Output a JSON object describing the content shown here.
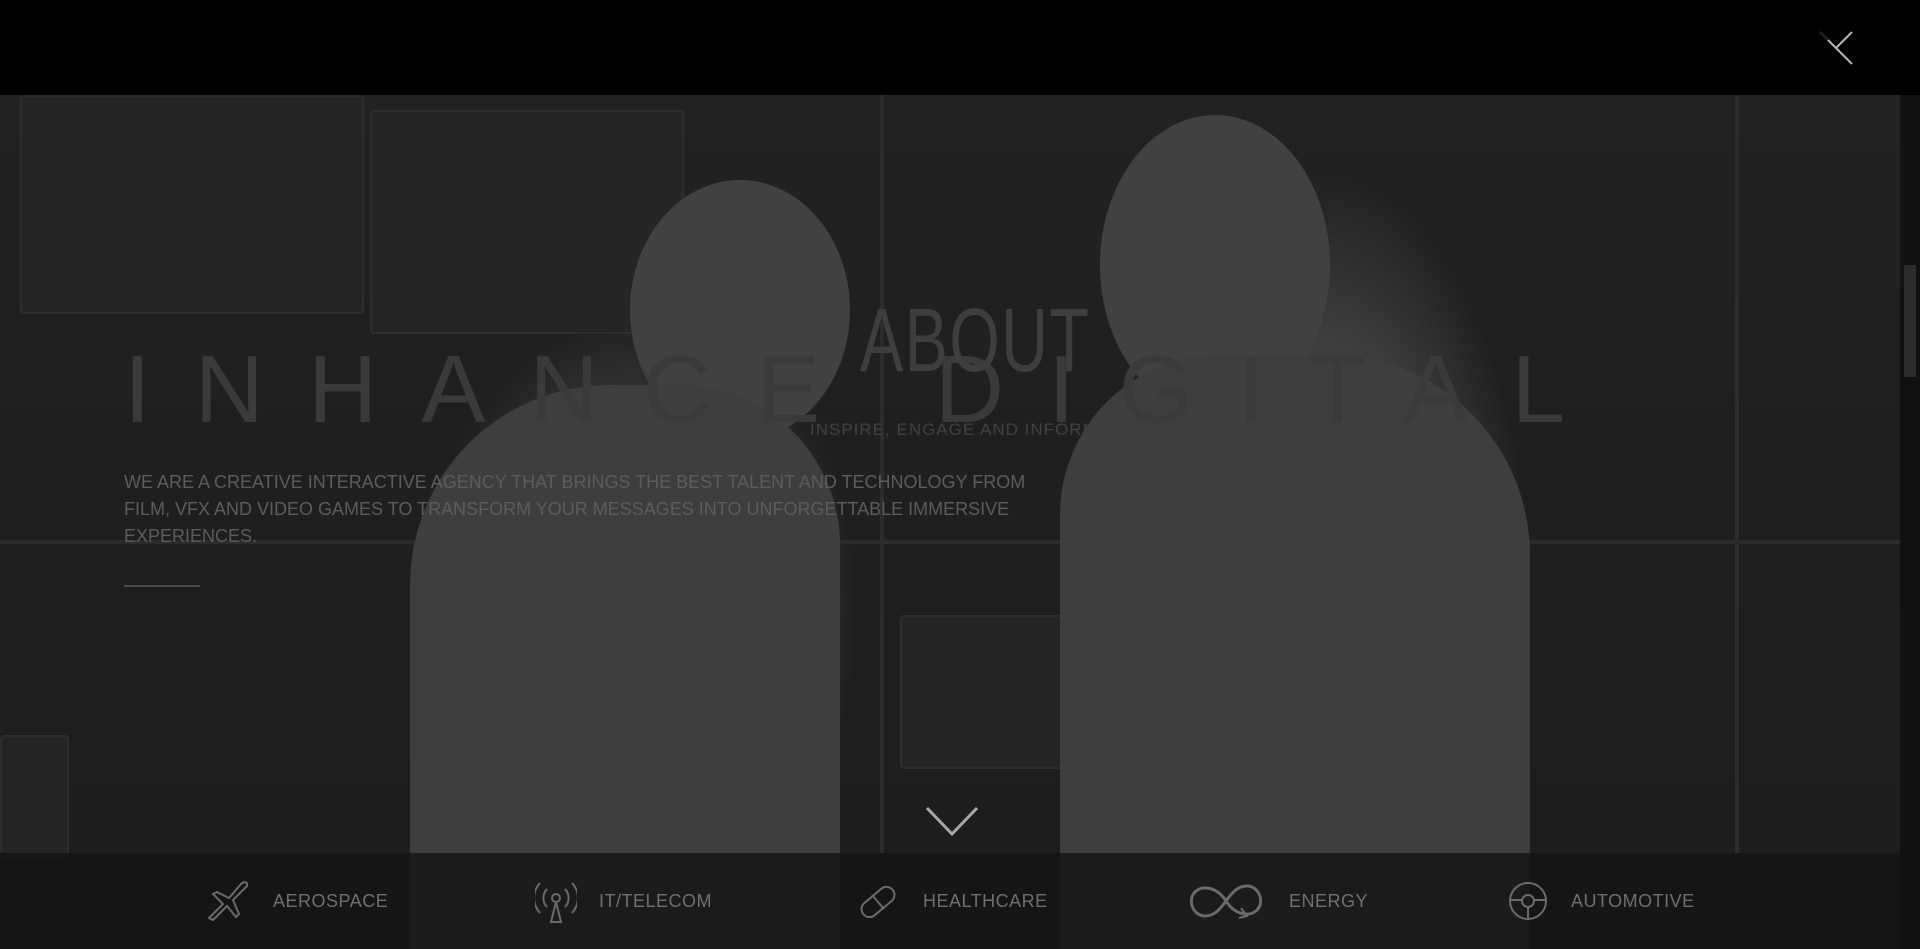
{
  "brand": {
    "name": "INHANCE DIGITAL"
  },
  "about": {
    "title": "ABOUT",
    "subtitle": "INSPIRE, ENGAGE AND INFORM",
    "tagline": "WE ARE A CREATIVE INTERACTIVE AGENCY THAT BRINGS THE BEST TALENT AND TECHNOLOGY FROM FILM, VFX AND VIDEO GAMES TO TRANSFORM YOUR MESSAGES INTO UNFORGETTABLE IMMERSIVE EXPERIENCES."
  },
  "industries": [
    {
      "label": "AEROSPACE",
      "icon": "airplane-icon"
    },
    {
      "label": "IT/TELECOM",
      "icon": "antenna-icon"
    },
    {
      "label": "HEALTHCARE",
      "icon": "pill-icon"
    },
    {
      "label": "ENERGY",
      "icon": "infinity-recycle-icon"
    },
    {
      "label": "AUTOMOTIVE",
      "icon": "steering-wheel-icon"
    }
  ],
  "colors": {
    "background": "#000000",
    "overlay": "#262626",
    "text_muted": "#6f6f6f"
  }
}
